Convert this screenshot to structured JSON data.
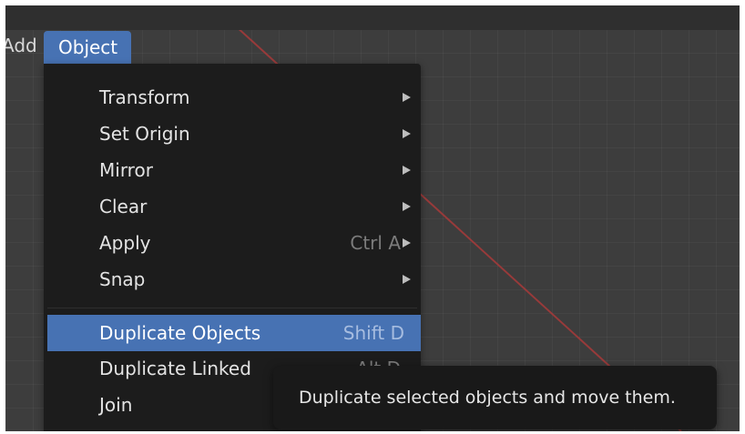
{
  "menubar": {
    "add_label": "Add",
    "object_label": "Object"
  },
  "object_menu": {
    "items": [
      {
        "label": "Transform",
        "shortcut": "",
        "submenu": true
      },
      {
        "label": "Set Origin",
        "shortcut": "",
        "submenu": true
      },
      {
        "label": "Mirror",
        "shortcut": "",
        "submenu": true
      },
      {
        "label": "Clear",
        "shortcut": "",
        "submenu": true
      },
      {
        "label": "Apply",
        "shortcut": "Ctrl A",
        "submenu": true
      },
      {
        "label": "Snap",
        "shortcut": "",
        "submenu": true
      },
      {
        "label": "Duplicate Objects",
        "shortcut": "Shift D",
        "submenu": false,
        "highlighted": true
      },
      {
        "label": "Duplicate Linked",
        "shortcut": "Alt D",
        "submenu": false
      },
      {
        "label": "Join",
        "shortcut": "",
        "submenu": false
      }
    ]
  },
  "tooltip": {
    "text": "Duplicate selected objects and move them."
  },
  "colors": {
    "accent": "#4772b3",
    "menu_bg": "#1c1c1c",
    "viewport_bg": "#3d3d3d",
    "axis_red": "#a83a3a"
  }
}
